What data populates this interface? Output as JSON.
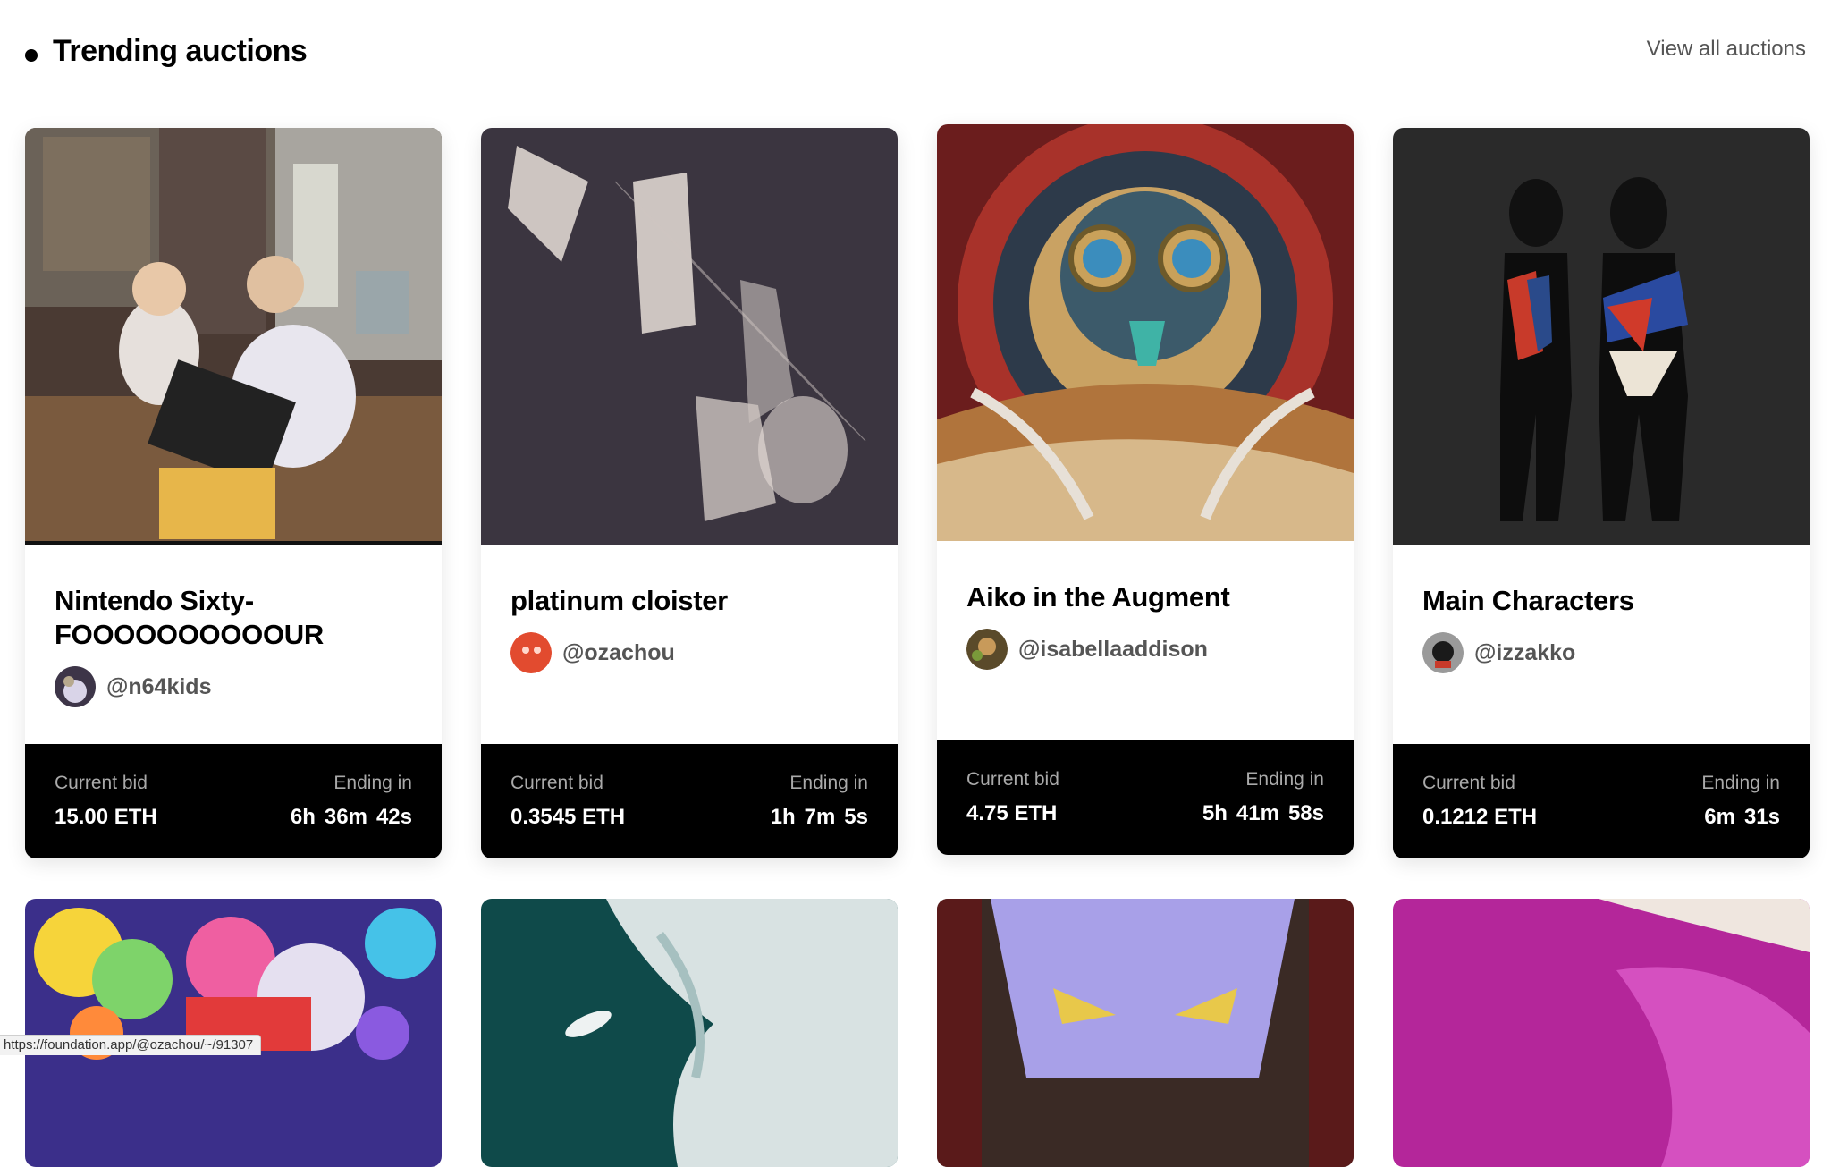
{
  "header": {
    "title": "Trending auctions",
    "view_all": "View all auctions"
  },
  "cards": [
    {
      "title": "Nintendo Sixty-FOOOOOOOOOOUR",
      "creator": "@n64kids",
      "bid_label": "Current bid",
      "bid": "15.00 ETH",
      "end_label": "Ending in",
      "ending": {
        "h": "6h",
        "m": "36m",
        "s": "42s"
      }
    },
    {
      "title": "platinum cloister",
      "creator": "@ozachou",
      "bid_label": "Current bid",
      "bid": "0.3545 ETH",
      "end_label": "Ending in",
      "ending": {
        "h": "1h",
        "m": "7m",
        "s": "5s"
      }
    },
    {
      "title": "Aiko in the Augment",
      "creator": "@isabellaaddison",
      "bid_label": "Current bid",
      "bid": "4.75 ETH",
      "end_label": "Ending in",
      "ending": {
        "h": "5h",
        "m": "41m",
        "s": "58s"
      }
    },
    {
      "title": "Main Characters",
      "creator": "@izzakko",
      "bid_label": "Current bid",
      "bid": "0.1212 ETH",
      "end_label": "Ending in",
      "ending": {
        "m": "6m",
        "s": "31s"
      }
    }
  ],
  "status_url": "https://foundation.app/@ozachou/~/91307",
  "colors": {
    "bid_bar": "#000000",
    "muted_label": "#a9a9a9",
    "handle": "#555555"
  },
  "icons": {
    "bullet": "bullet-dot-icon"
  }
}
